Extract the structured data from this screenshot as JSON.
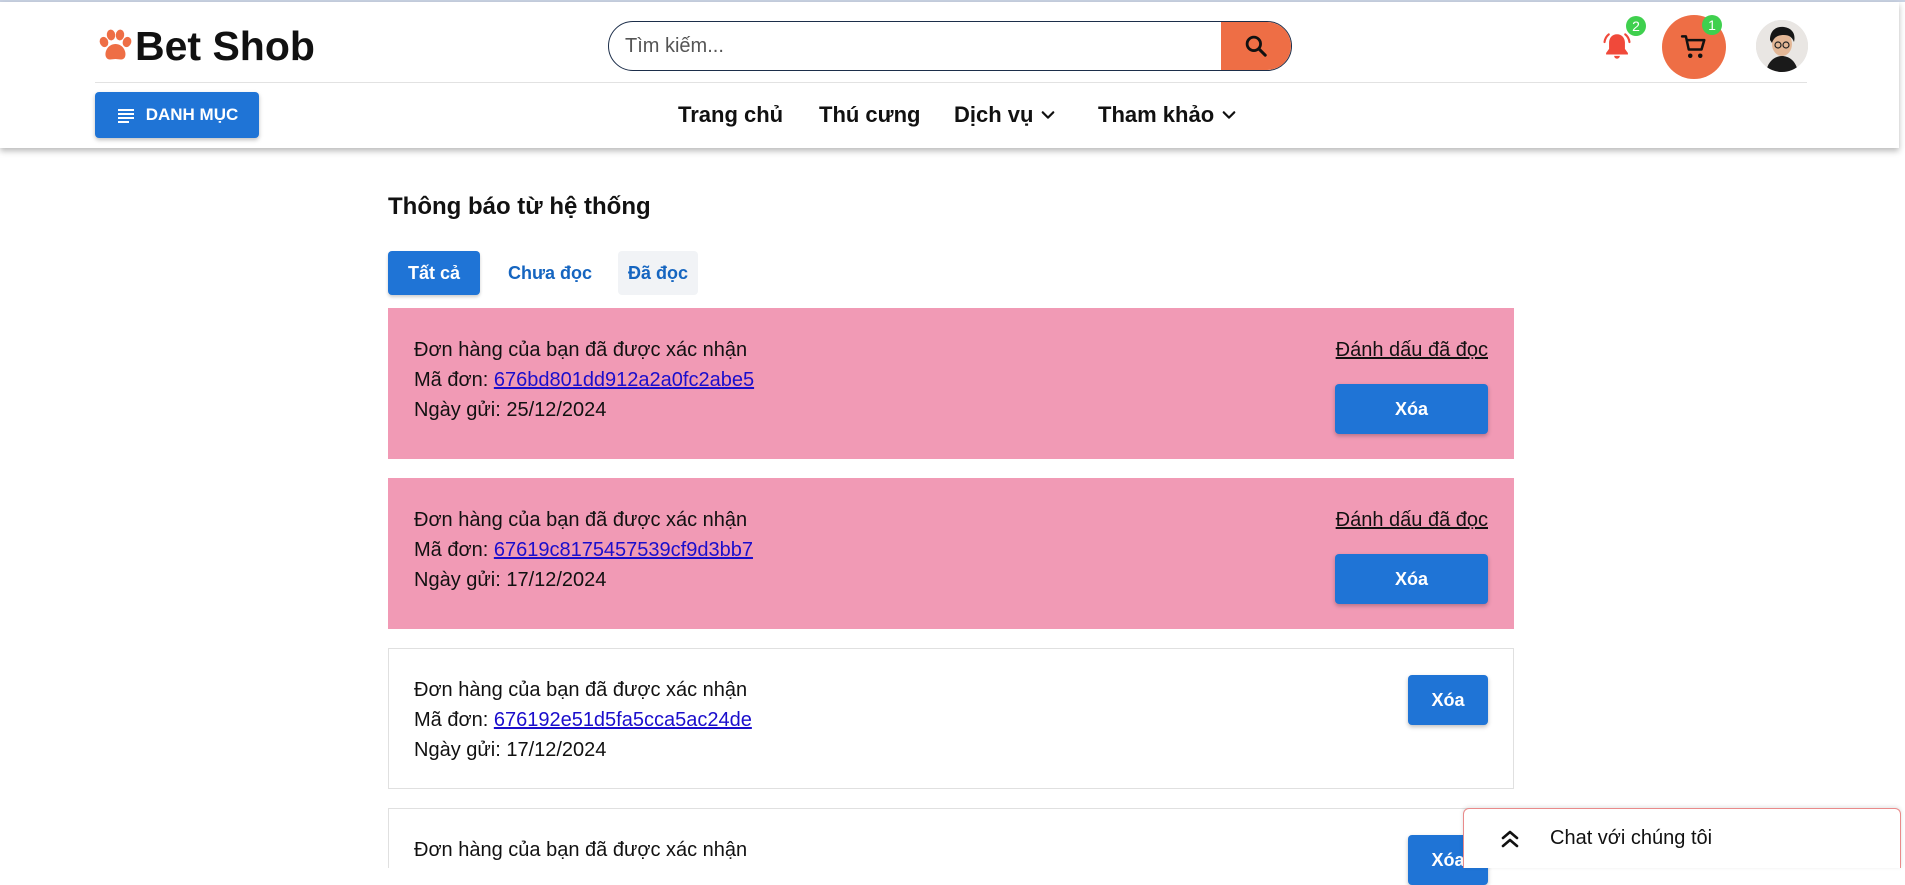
{
  "brand": {
    "name": "Bet Shob",
    "accent_color": "#ee6e45",
    "logo_icon": "paw-icon"
  },
  "search": {
    "placeholder": "Tìm kiếm...",
    "value": "",
    "button_icon": "search-icon"
  },
  "header": {
    "notification_icon": "bell-icon",
    "notification_count": "2",
    "cart_icon": "cart-icon",
    "cart_count": "1",
    "badge_color": "#3fd04e"
  },
  "category_button": {
    "label": "DANH MỤC",
    "icon": "menu-lines-icon",
    "color": "#1f74d6"
  },
  "nav": {
    "items": [
      {
        "label": "Trang chủ",
        "has_dropdown": false
      },
      {
        "label": "Thú cưng",
        "has_dropdown": false
      },
      {
        "label": "Dịch vụ",
        "has_dropdown": true
      },
      {
        "label": "Tham khảo",
        "has_dropdown": true
      }
    ]
  },
  "page": {
    "title": "Thông báo từ hệ thống"
  },
  "tabs": [
    {
      "label": "Tất cả",
      "state": "active"
    },
    {
      "label": "Chưa đọc",
      "state": "inactive"
    },
    {
      "label": "Đã đọc",
      "state": "inactive"
    }
  ],
  "notifications": [
    {
      "message": "Đơn hàng của bạn đã được xác nhận",
      "order_label": "Mã đơn:",
      "order_id": "676bd801dd912a2a0fc2abe5",
      "date_label": "Ngày gửi:",
      "date": "25/12/2024",
      "unread": true,
      "mark_read_label": "Đánh dấu đã đọc",
      "delete_label": "Xóa"
    },
    {
      "message": "Đơn hàng của bạn đã được xác nhận",
      "order_label": "Mã đơn:",
      "order_id": "67619c8175457539cf9d3bb7",
      "date_label": "Ngày gửi:",
      "date": "17/12/2024",
      "unread": true,
      "mark_read_label": "Đánh dấu đã đọc",
      "delete_label": "Xóa"
    },
    {
      "message": "Đơn hàng của bạn đã được xác nhận",
      "order_label": "Mã đơn:",
      "order_id": "676192e51d5fa5cca5ac24de",
      "date_label": "Ngày gửi:",
      "date": "17/12/2024",
      "unread": false,
      "delete_label": "Xóa"
    },
    {
      "message": "Đơn hàng của bạn đã được xác nhận",
      "unread": false,
      "delete_label": "Xóa"
    }
  ],
  "colors": {
    "unread_bg": "#f19ab5",
    "primary": "#1f74d6",
    "link": "#1a0dcc"
  },
  "chat": {
    "label": "Chat với chúng tôi",
    "icon": "double-chevron-up-icon"
  }
}
